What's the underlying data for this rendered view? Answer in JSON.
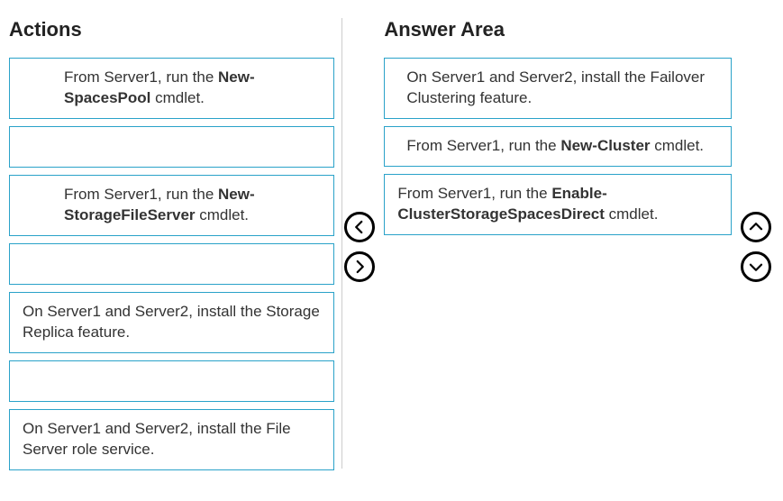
{
  "actions": {
    "title": "Actions",
    "items": [
      {
        "prefix": "From Server1, run the ",
        "cmd": "New-\nSpacesPool",
        "suffix": " cmdlet.",
        "empty": false,
        "indent": true
      },
      {
        "prefix": "",
        "cmd": "",
        "suffix": "",
        "empty": true
      },
      {
        "prefix": "From Server1, run the ",
        "cmd": "New-\nStorageFileServer",
        "suffix": " cmdlet.",
        "empty": false,
        "indent": true
      },
      {
        "prefix": "",
        "cmd": "",
        "suffix": "",
        "empty": true
      },
      {
        "prefix": "On Server1 and Server2, install the Storage Replica feature.",
        "cmd": "",
        "suffix": "",
        "empty": false,
        "indent": false
      },
      {
        "prefix": "",
        "cmd": "",
        "suffix": "",
        "empty": true
      },
      {
        "prefix": "On Server1 and Server2, install the File Server role service.",
        "cmd": "",
        "suffix": "",
        "empty": false,
        "indent": false
      }
    ]
  },
  "answer": {
    "title": "Answer Area",
    "items": [
      {
        "prefix": "On Server1 and Server2, install the Failover Clustering feature.",
        "cmd": "",
        "suffix": ""
      },
      {
        "prefix": "From Server1, run the ",
        "cmd": "New-Cluster",
        "suffix": " cmdlet."
      },
      {
        "prefix": "From Server1, run the ",
        "cmd": "Enable-ClusterStorageSpacesDirect",
        "suffix": " cmdlet."
      }
    ]
  }
}
